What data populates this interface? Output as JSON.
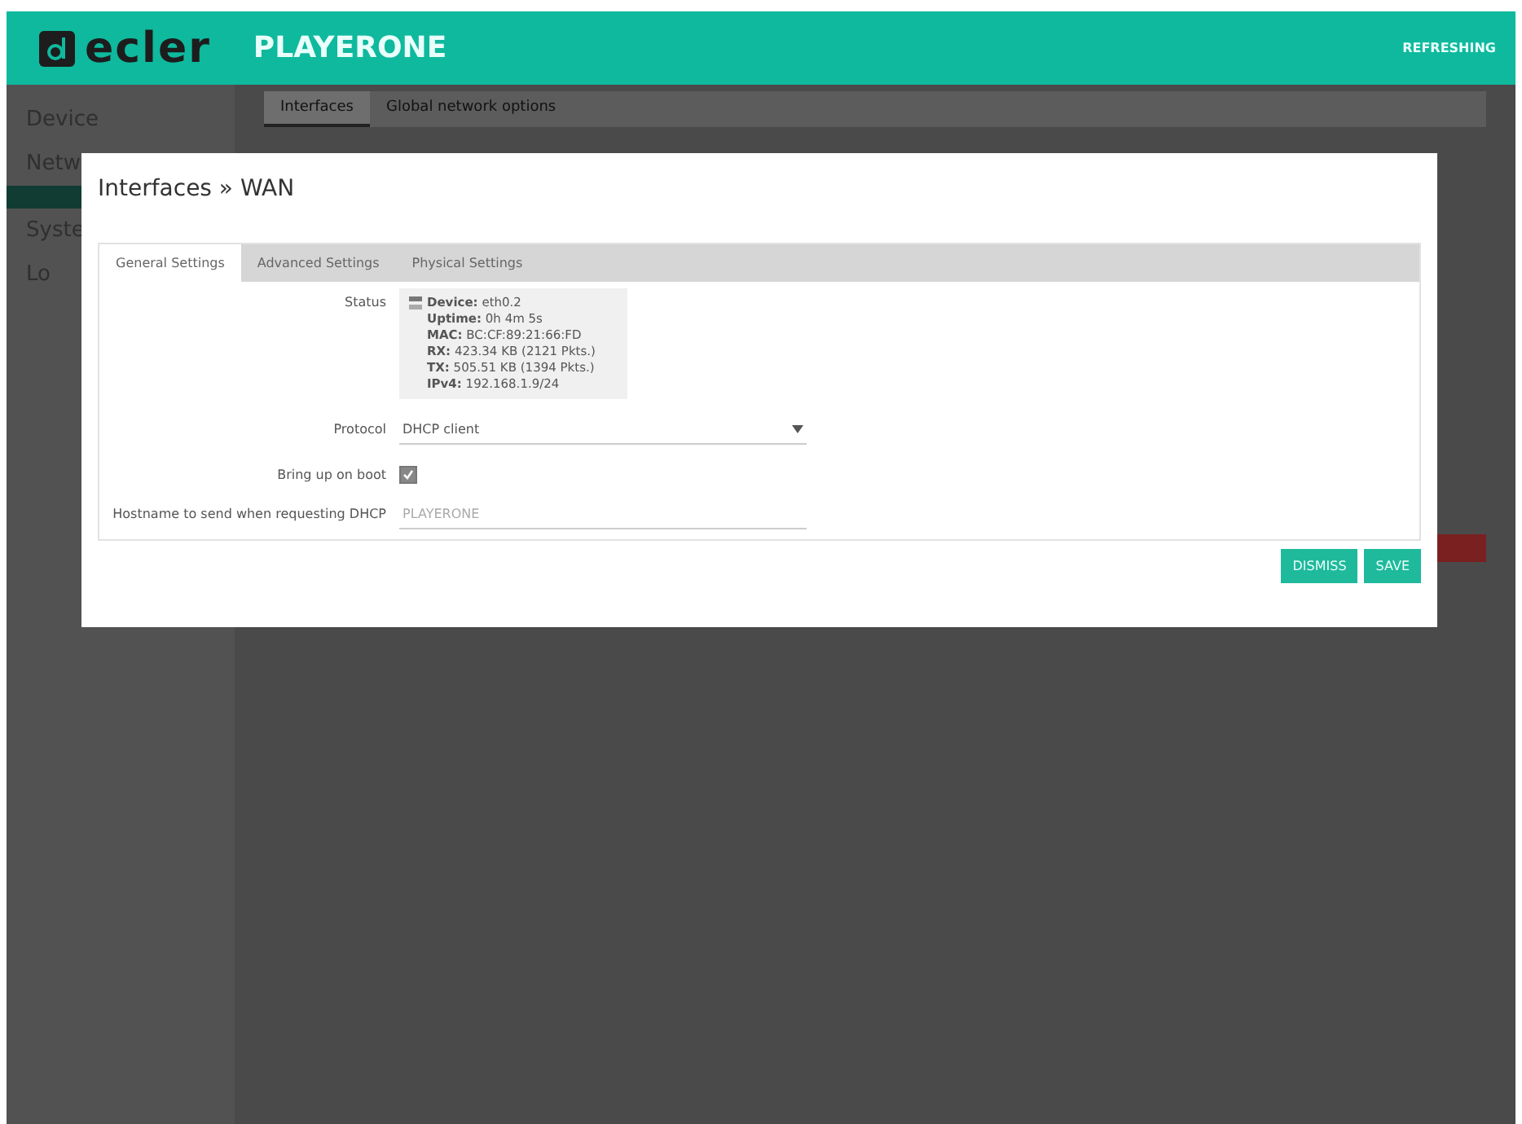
{
  "header": {
    "logo": "ecler",
    "product": "PLAYERONE",
    "status": "REFRESHING"
  },
  "sidebar": {
    "items": [
      {
        "label": "Device",
        "expanded": false
      },
      {
        "label": "Netw",
        "expanded": true
      },
      {
        "label": "Syste",
        "expanded": false
      },
      {
        "label": "Lo",
        "expanded": false
      }
    ]
  },
  "background_tabs": [
    {
      "label": "Interfaces",
      "selected": true
    },
    {
      "label": "Global network options",
      "selected": false
    }
  ],
  "modal": {
    "title": "Interfaces » WAN",
    "tabs": [
      {
        "label": "General Settings",
        "selected": true
      },
      {
        "label": "Advanced Settings",
        "selected": false
      },
      {
        "label": "Physical Settings",
        "selected": false
      }
    ],
    "status": {
      "label": "Status",
      "lines": [
        {
          "key": "Device:",
          "value": "eth0.2"
        },
        {
          "key": "Uptime:",
          "value": "0h 4m 5s"
        },
        {
          "key": "MAC:",
          "value": "BC:CF:89:21:66:FD"
        },
        {
          "key": "RX:",
          "value": "423.34 KB (2121 Pkts.)"
        },
        {
          "key": "TX:",
          "value": "505.51 KB (1394 Pkts.)"
        },
        {
          "key": "IPv4:",
          "value": "192.168.1.9/24"
        }
      ]
    },
    "protocol": {
      "label": "Protocol",
      "value": "DHCP client"
    },
    "bring_up": {
      "label": "Bring up on boot",
      "checked": true
    },
    "hostname": {
      "label": "Hostname to send when requesting DHCP",
      "placeholder": "PLAYERONE"
    },
    "buttons": [
      "DISMISS",
      "SAVE"
    ]
  }
}
